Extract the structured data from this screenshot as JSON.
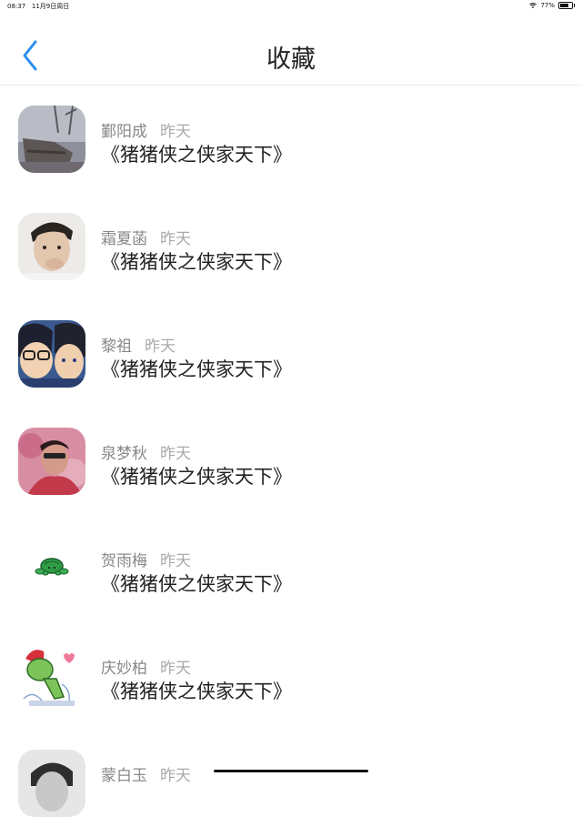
{
  "status_bar": {
    "time": "08:37",
    "date": "11月9日周日",
    "battery": "77%",
    "battery_level": 0.77
  },
  "nav": {
    "title": "收藏",
    "back_icon": "chevron-left-icon",
    "accent": "#2b8ef0"
  },
  "favorites": [
    {
      "name": "鄞阳成",
      "date": "昨天",
      "title": "《猪猪侠之侠家天下》"
    },
    {
      "name": "霜夏菡",
      "date": "昨天",
      "title": "《猪猪侠之侠家天下》"
    },
    {
      "name": "黎祖",
      "date": "昨天",
      "title": "《猪猪侠之侠家天下》"
    },
    {
      "name": "泉梦秋",
      "date": "昨天",
      "title": "《猪猪侠之侠家天下》"
    },
    {
      "name": "贺雨梅",
      "date": "昨天",
      "title": "《猪猪侠之侠家天下》"
    },
    {
      "name": "庆妙柏",
      "date": "昨天",
      "title": "《猪猪侠之侠家天下》"
    },
    {
      "name": "蒙白玉",
      "date": "昨天",
      "title": ""
    }
  ]
}
